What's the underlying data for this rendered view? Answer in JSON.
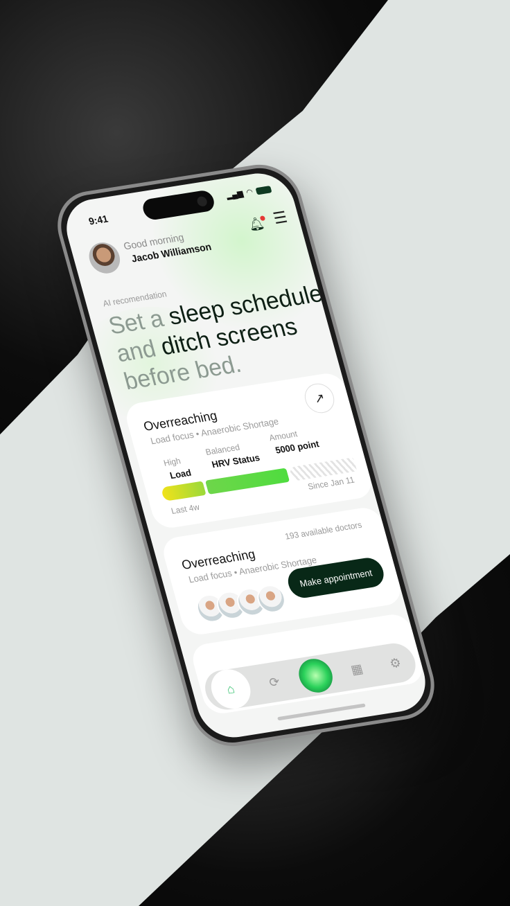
{
  "status_bar": {
    "time": "9:41",
    "signal": "▂▄▆",
    "wifi": "wifi-icon"
  },
  "header": {
    "greeting": "Good morning",
    "user_name": "Jacob Williamson"
  },
  "recommendation": {
    "label": "AI recomendation",
    "parts": [
      {
        "text": "Set a ",
        "muted": true
      },
      {
        "text": "sleep schedule ",
        "muted": false
      },
      {
        "text": "and ",
        "muted": true
      },
      {
        "text": "ditch screens ",
        "muted": false
      },
      {
        "text": "before bed.",
        "muted": true
      }
    ]
  },
  "load_card": {
    "title": "Overreaching",
    "subtitle": "Load focus • Anaerobic Shortage",
    "arrow": "↗",
    "stats": [
      {
        "label": "High",
        "value": "Load"
      },
      {
        "label": "Balanced",
        "value": "HRV Status"
      },
      {
        "label": "Amount",
        "value": "5000 point"
      }
    ],
    "range_start": "Last 4w",
    "range_end": "Since Jan 11"
  },
  "doctor_card": {
    "title": "Overreaching",
    "subtitle": "Load focus • Anaerobic Shortage",
    "available": "193 available doctors",
    "button": "Make appointment"
  },
  "colors": {
    "accent": "#082817",
    "bar_yellow": "#f1e21a",
    "bar_green": "#4fdc3f",
    "home_icon": "#2fbf6a"
  }
}
